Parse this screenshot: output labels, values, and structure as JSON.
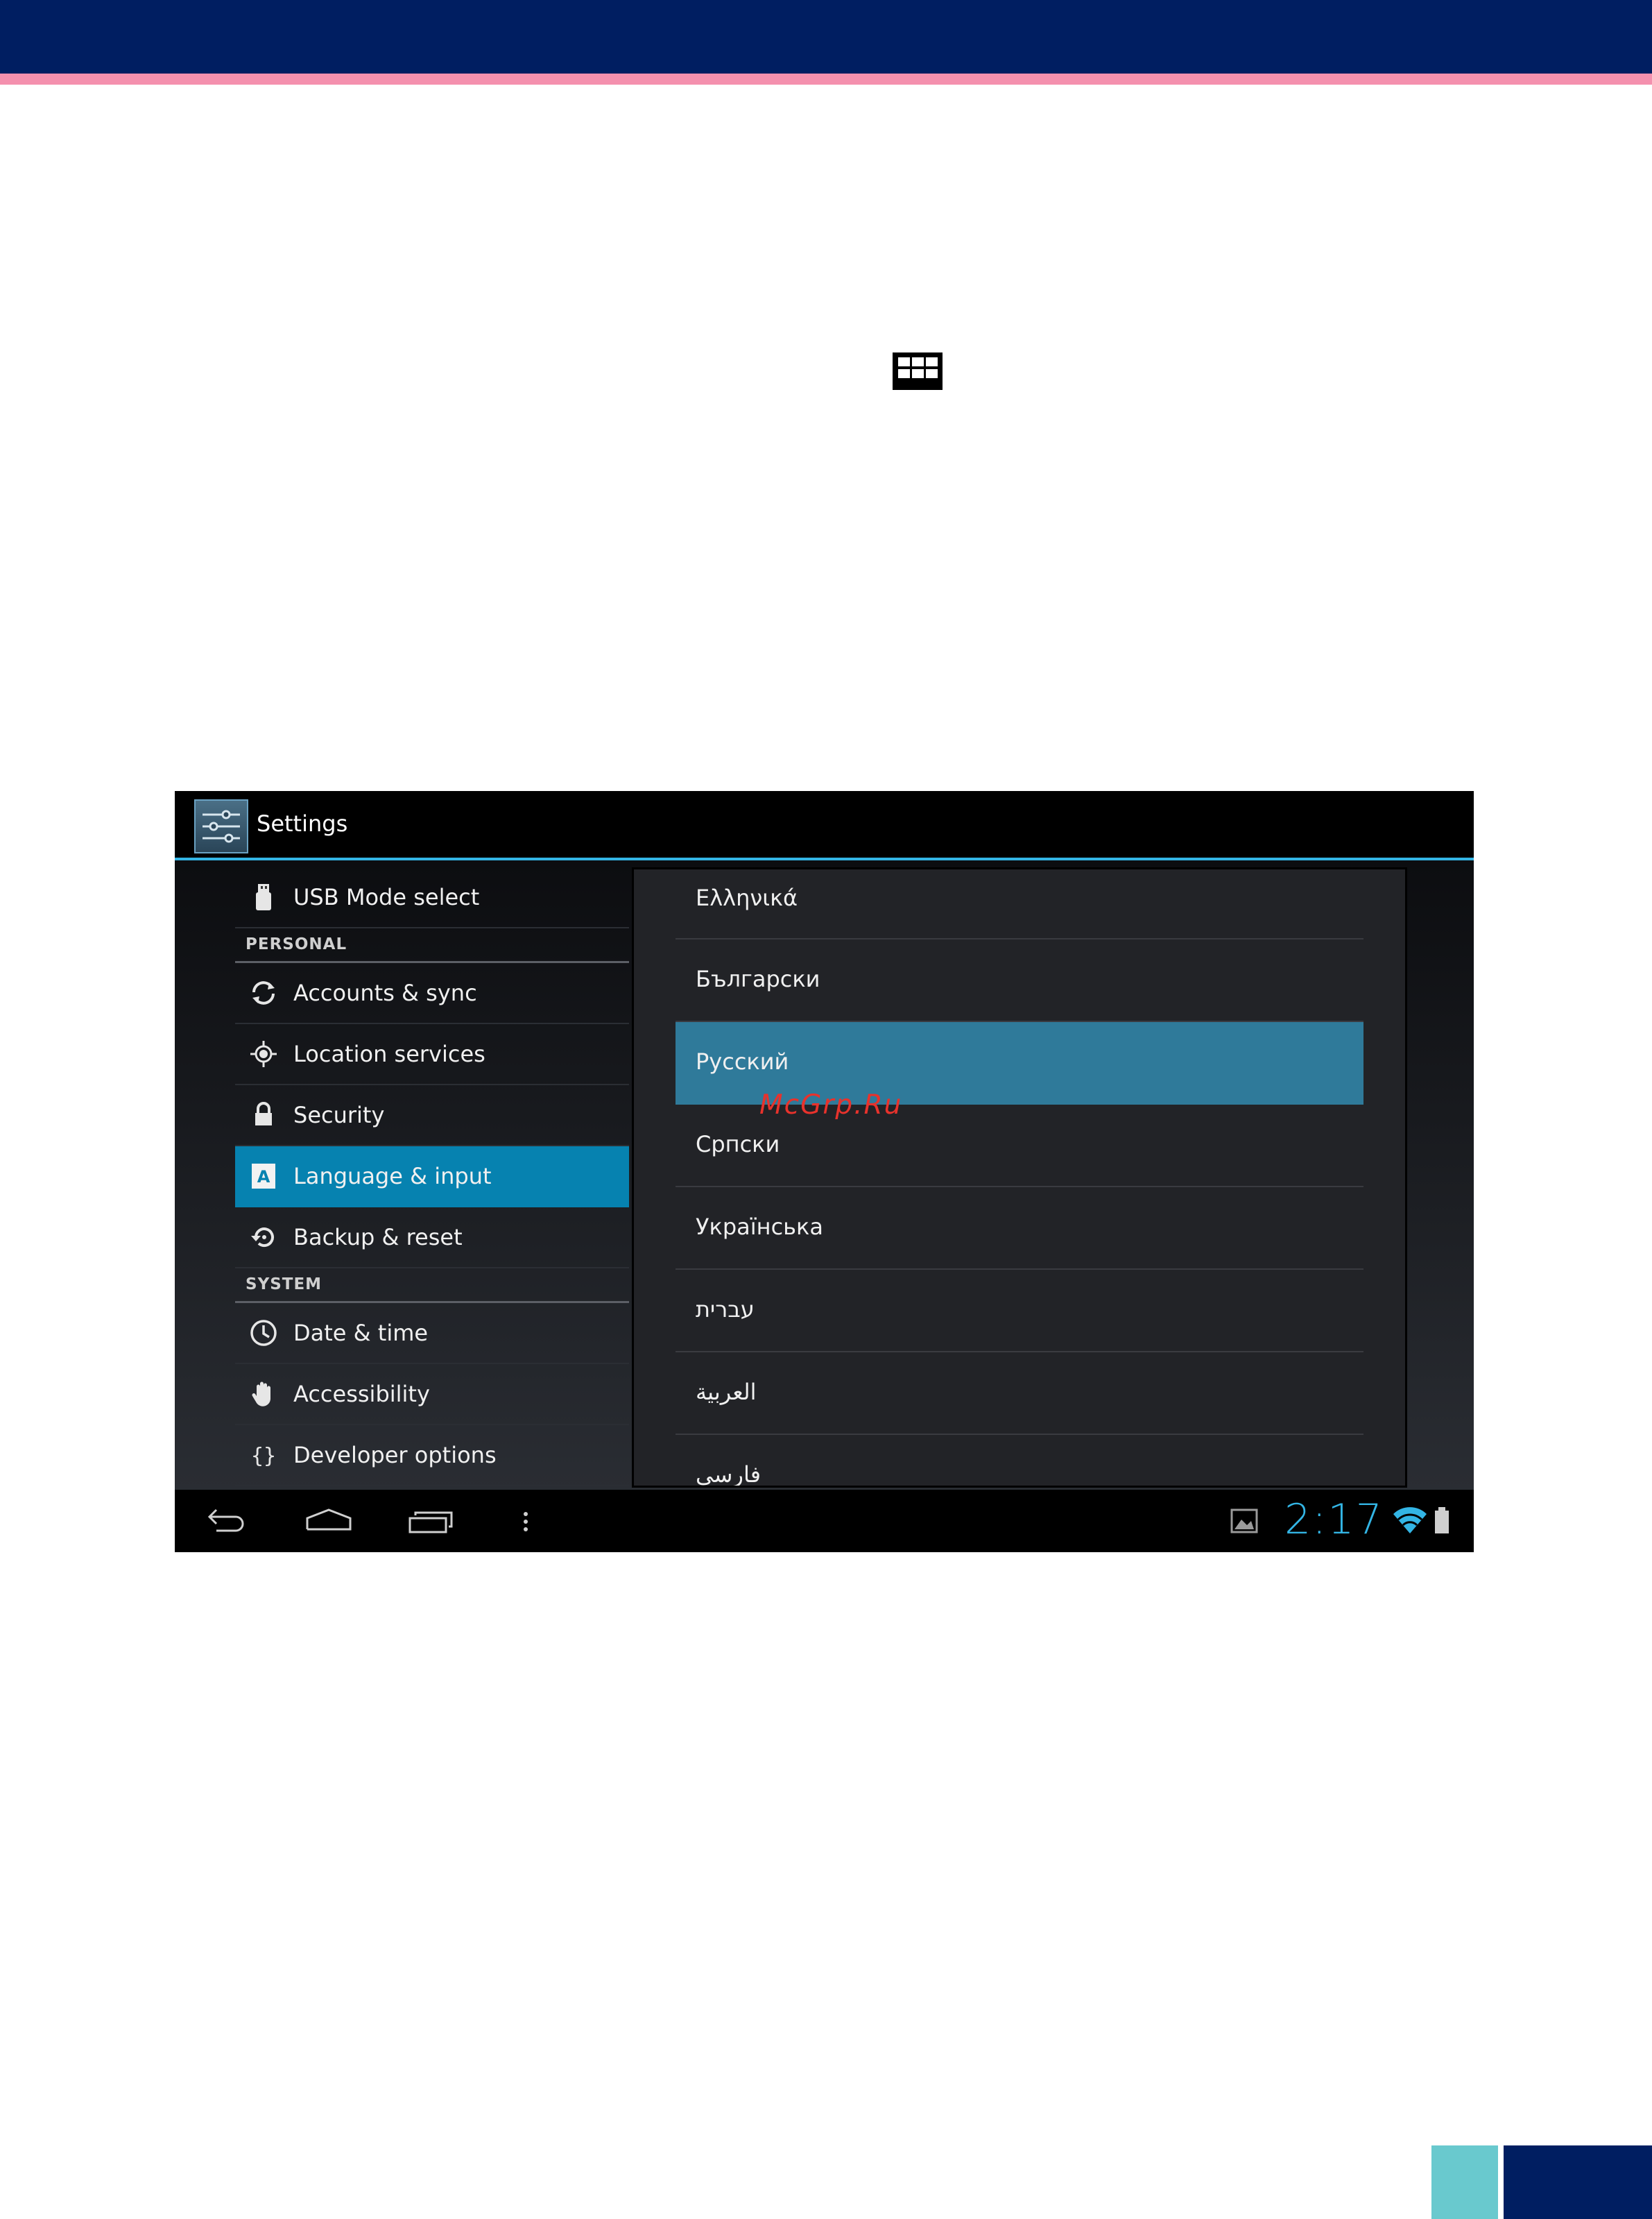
{
  "action_bar": {
    "title": "Settings"
  },
  "left_pane": {
    "usb_mode": "USB Mode select",
    "personal_header": "PERSONAL",
    "accounts": "Accounts & sync",
    "location": "Location services",
    "security": "Security",
    "language": "Language & input",
    "backup": "Backup & reset",
    "system_header": "SYSTEM",
    "date_time": "Date & time",
    "accessibility": "Accessibility",
    "developer": "Developer options"
  },
  "language_dialog": {
    "items": [
      "Ελληνικά",
      "Български",
      "Русский",
      "Српски",
      "Українська",
      "עברית",
      "العربية",
      "فارسی"
    ],
    "selected": "Русский"
  },
  "watermark": "McGrp.Ru",
  "status": {
    "clock": "2:17"
  },
  "colors": {
    "header_navy": "#001e61",
    "header_stripe": "#f490ae",
    "holo_blue": "#33b5e5",
    "active_item": "#0682b0",
    "selected_item": "#2f7a9a",
    "corner_teal": "#69c9ce"
  }
}
